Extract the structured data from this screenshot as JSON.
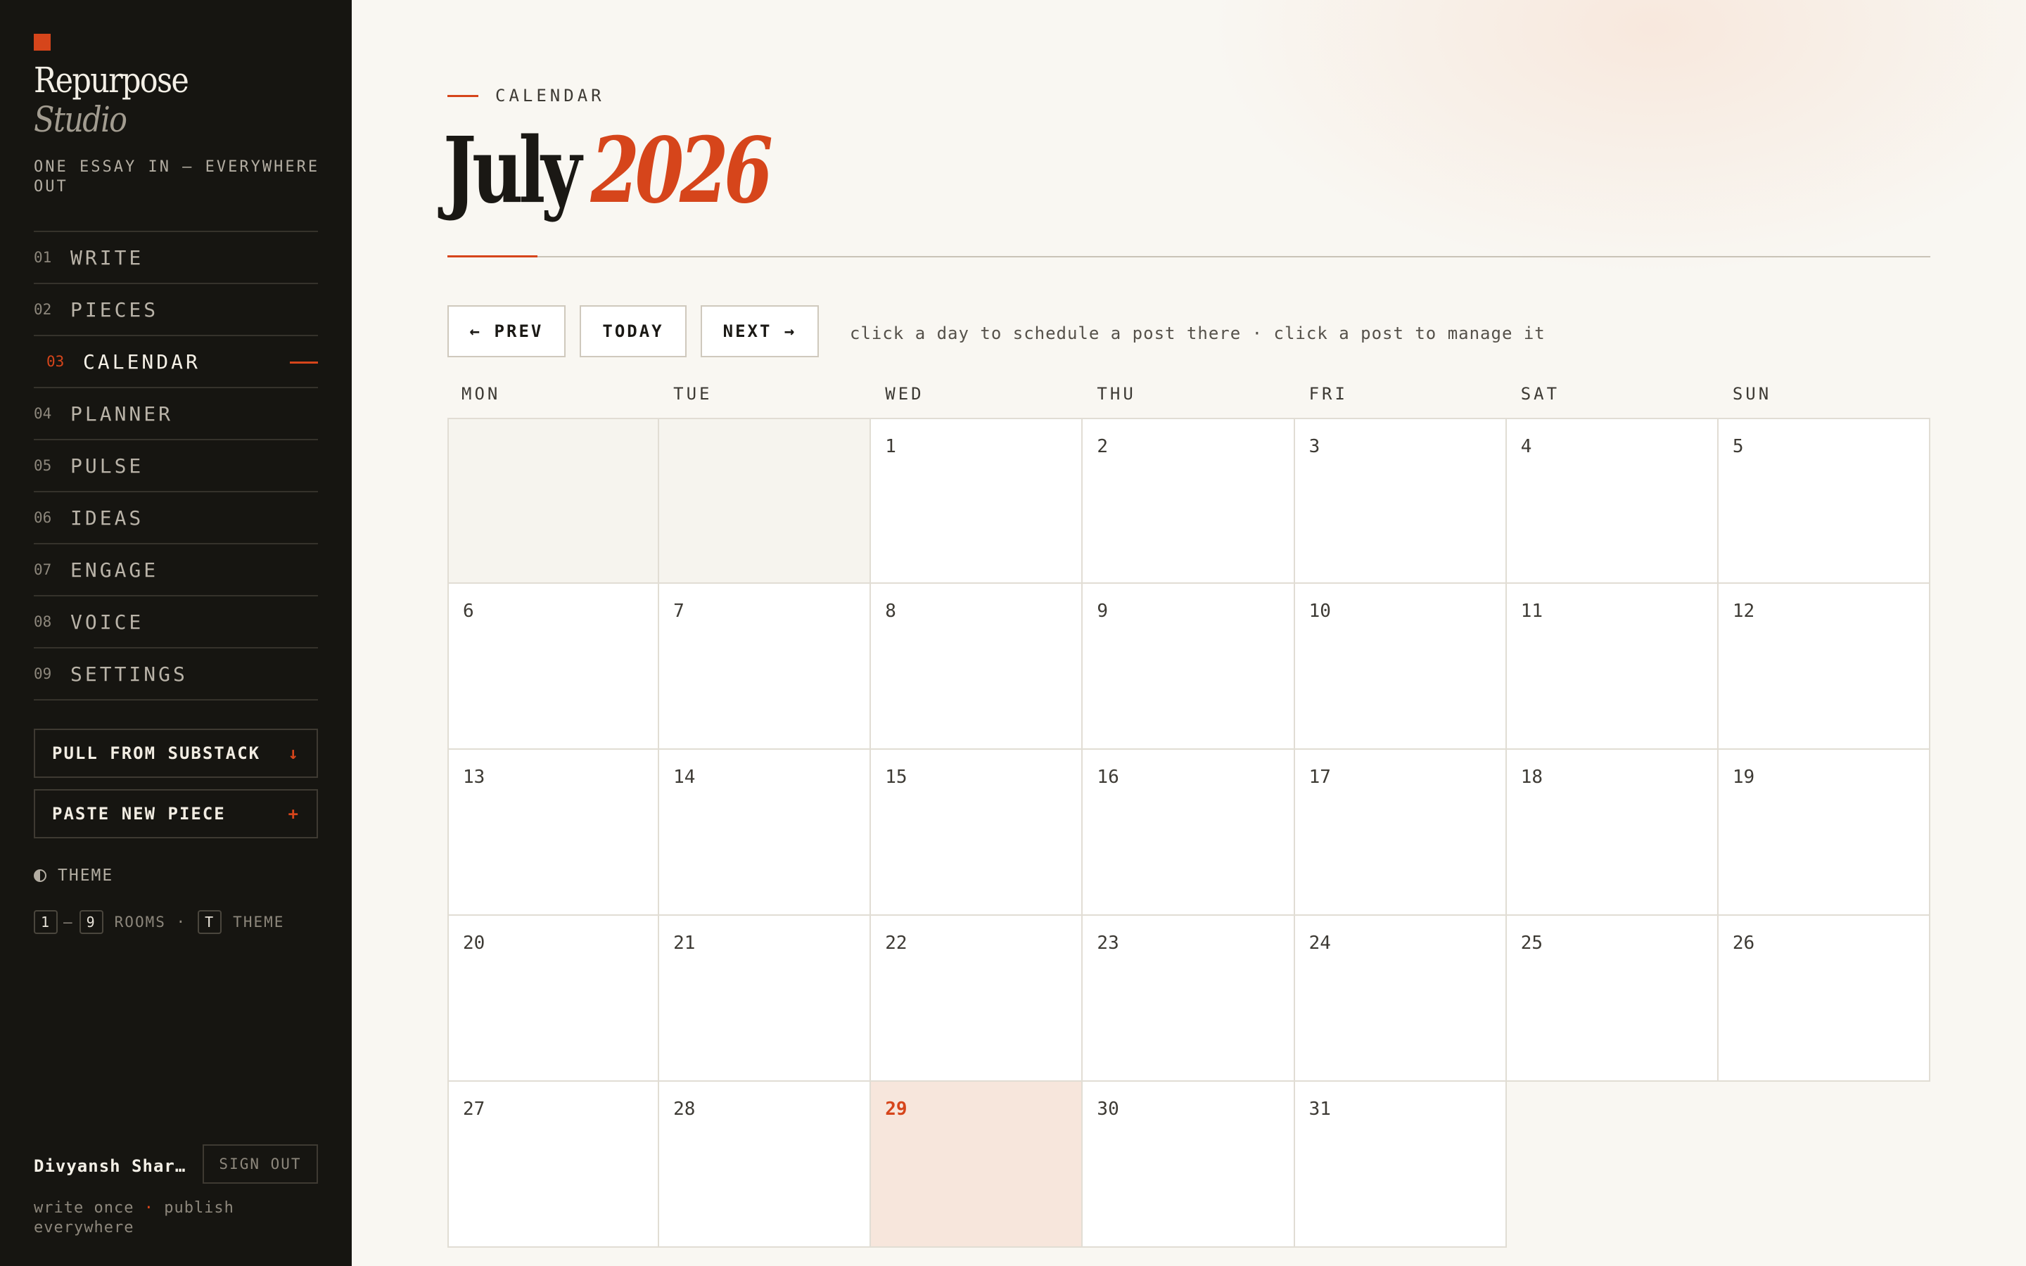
{
  "brand": {
    "name": "Repurpose",
    "sub": "Studio",
    "tagline": "ONE ESSAY IN — EVERYWHERE OUT"
  },
  "nav": [
    {
      "num": "01",
      "label": "WRITE"
    },
    {
      "num": "02",
      "label": "PIECES"
    },
    {
      "num": "03",
      "label": "CALENDAR",
      "active": true
    },
    {
      "num": "04",
      "label": "PLANNER"
    },
    {
      "num": "05",
      "label": "PULSE"
    },
    {
      "num": "06",
      "label": "IDEAS"
    },
    {
      "num": "07",
      "label": "ENGAGE"
    },
    {
      "num": "08",
      "label": "VOICE"
    },
    {
      "num": "09",
      "label": "SETTINGS"
    }
  ],
  "actions": {
    "pull_label": "PULL FROM SUBSTACK",
    "pull_glyph": "↓",
    "paste_label": "PASTE NEW PIECE",
    "paste_glyph": "+"
  },
  "theme": {
    "label": "THEME"
  },
  "shortcuts": {
    "key_from": "1",
    "sep": "–",
    "key_to": "9",
    "rooms": "ROOMS ·",
    "key_theme": "T",
    "theme": "THEME"
  },
  "user": {
    "name": "Divyansh Sharma",
    "signout": "SIGN OUT"
  },
  "footer": {
    "part1": "write once",
    "dot": "·",
    "part2": "publish everywhere"
  },
  "page": {
    "eyebrow": "CALENDAR",
    "month": "July",
    "year": "2026"
  },
  "controls": {
    "prev": "← PREV",
    "today": "TODAY",
    "next": "NEXT →",
    "hint": "click a day to schedule a post there · click a post to manage it"
  },
  "calendar": {
    "weekdays": [
      "MON",
      "TUE",
      "WED",
      "THU",
      "FRI",
      "SAT",
      "SUN"
    ],
    "leading_blanks": 2,
    "days_in_month": 31,
    "today": 29
  },
  "colors": {
    "accent": "#d6451b",
    "sidebar_bg": "#161511",
    "today_bg": "#f7e6dc"
  }
}
